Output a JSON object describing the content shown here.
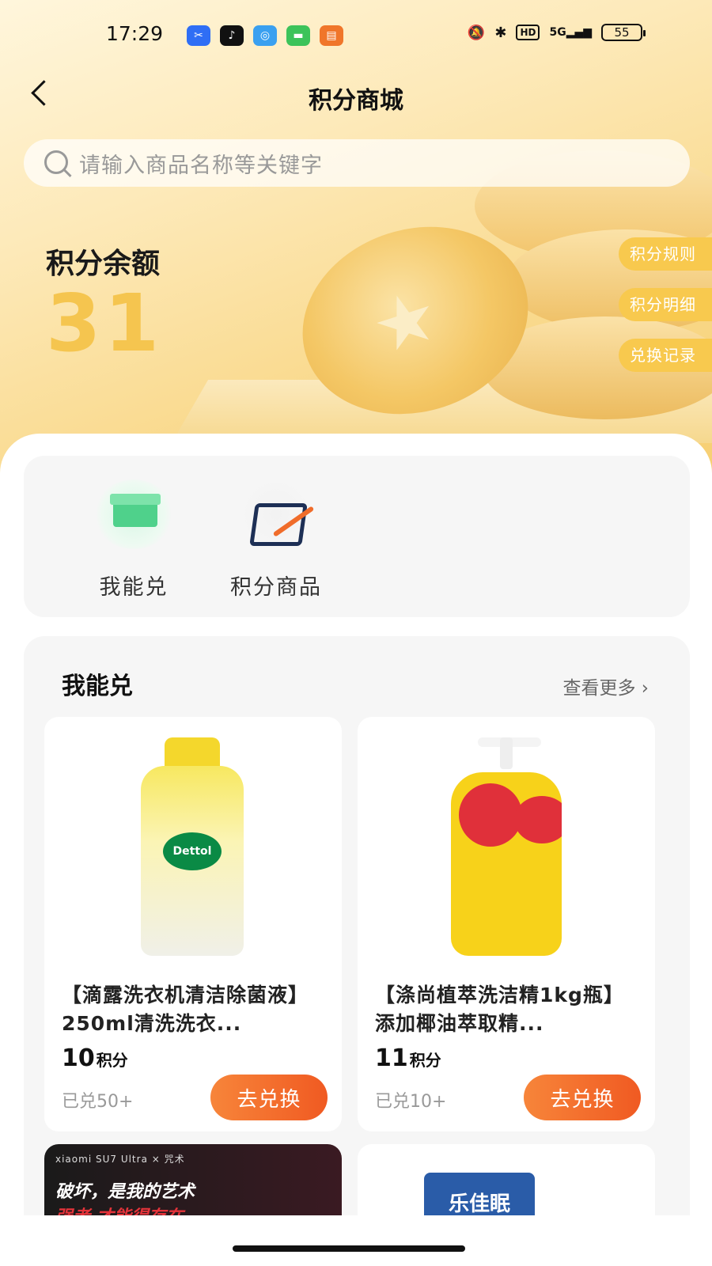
{
  "status_bar": {
    "time": "17:29",
    "apps": [
      {
        "icon": "scissor-app-icon",
        "glyph": "✂",
        "color": "#2f6ef5"
      },
      {
        "icon": "tiktok-icon",
        "glyph": "♪",
        "color": "#111111"
      },
      {
        "icon": "browser-icon",
        "glyph": "◎",
        "color": "#3aa0f0"
      },
      {
        "icon": "message-icon",
        "glyph": "▬",
        "color": "#3cc35a"
      },
      {
        "icon": "book-icon",
        "glyph": "▤",
        "color": "#f0762a"
      }
    ],
    "network": "5G",
    "hd": "HD",
    "battery": "55"
  },
  "header": {
    "title": "积分商城"
  },
  "search": {
    "placeholder": "请输入商品名称等关键字"
  },
  "balance": {
    "label": "积分余额",
    "value": "31"
  },
  "side_tags": [
    "积分规则",
    "积分明细",
    "兑换记录"
  ],
  "entries": [
    {
      "label": "我能兑",
      "icon": "gift-box-icon"
    },
    {
      "label": "积分商品",
      "icon": "shopping-bag-icon"
    }
  ],
  "section": {
    "title": "我能兑",
    "more": "查看更多 ›"
  },
  "products": [
    {
      "name": "【滴露洗衣机清洁除菌液】250ml清洗洗衣...",
      "points": "10",
      "points_unit": "积分",
      "sold": "已兑50+",
      "button": "去兑换",
      "brand": "Dettol"
    },
    {
      "name": "【涤尚植萃洗洁精1kg瓶】添加椰油萃取精...",
      "points": "11",
      "points_unit": "积分",
      "sold": "已兑10+",
      "button": "去兑换"
    }
  ],
  "partial": {
    "promo_top": "xiaomi SU7 Ultra × 咒术",
    "promo_line1": "破坏，是我的艺术",
    "promo_line2": "强者 才能得存在",
    "next_brand": "乐佳眠"
  },
  "colors": {
    "accent_gold": "#f5c54f",
    "button_orange": "#f05a22"
  }
}
